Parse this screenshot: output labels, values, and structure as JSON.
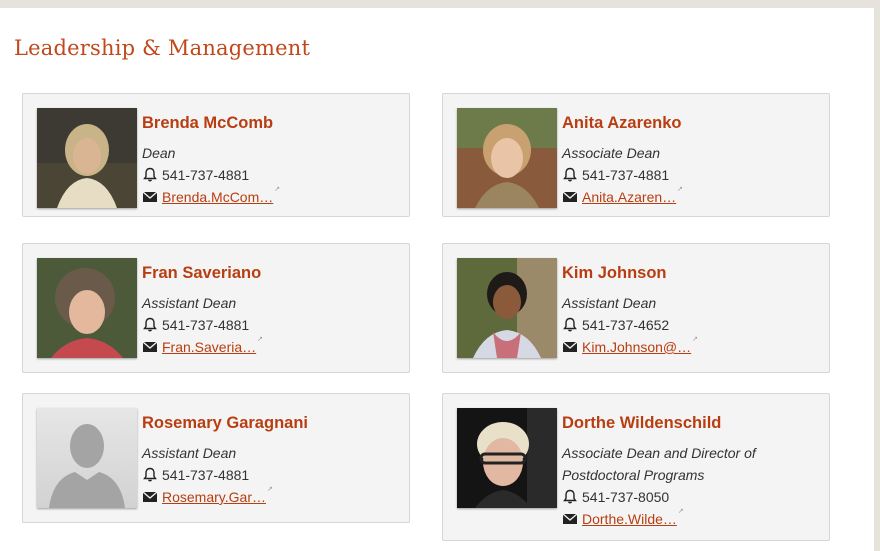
{
  "section": {
    "title": "Leadership & Management"
  },
  "people": [
    {
      "name": "Brenda McComb",
      "title": "Dean",
      "phone": "541-737-4881",
      "email": "Brenda.McCom…"
    },
    {
      "name": "Anita Azarenko",
      "title": "Associate Dean",
      "phone": "541-737-4881",
      "email": "Anita.Azaren…"
    },
    {
      "name": "Fran Saveriano",
      "title": "Assistant Dean",
      "phone": "541-737-4881",
      "email": "Fran.Saveria…"
    },
    {
      "name": "Kim Johnson",
      "title": "Assistant Dean",
      "phone": "541-737-4652",
      "email": "Kim.Johnson@…"
    },
    {
      "name": "Rosemary Garagnani",
      "title": "Assistant Dean",
      "phone": "541-737-4881",
      "email": "Rosemary.Gar…"
    },
    {
      "name": "Dorthe Wildenschild",
      "title": "Associate Dean and Director of",
      "title_line2": "Postdoctoral Programs",
      "phone": "541-737-8050",
      "email": "Dorthe.Wilde…"
    }
  ],
  "icons": {
    "phone": "bell-icon",
    "email": "envelope-icon",
    "external": "external-link-icon"
  },
  "colors": {
    "accent": "#c0481b",
    "card_bg": "#f4f4f4",
    "card_border": "#d6d6d6"
  }
}
